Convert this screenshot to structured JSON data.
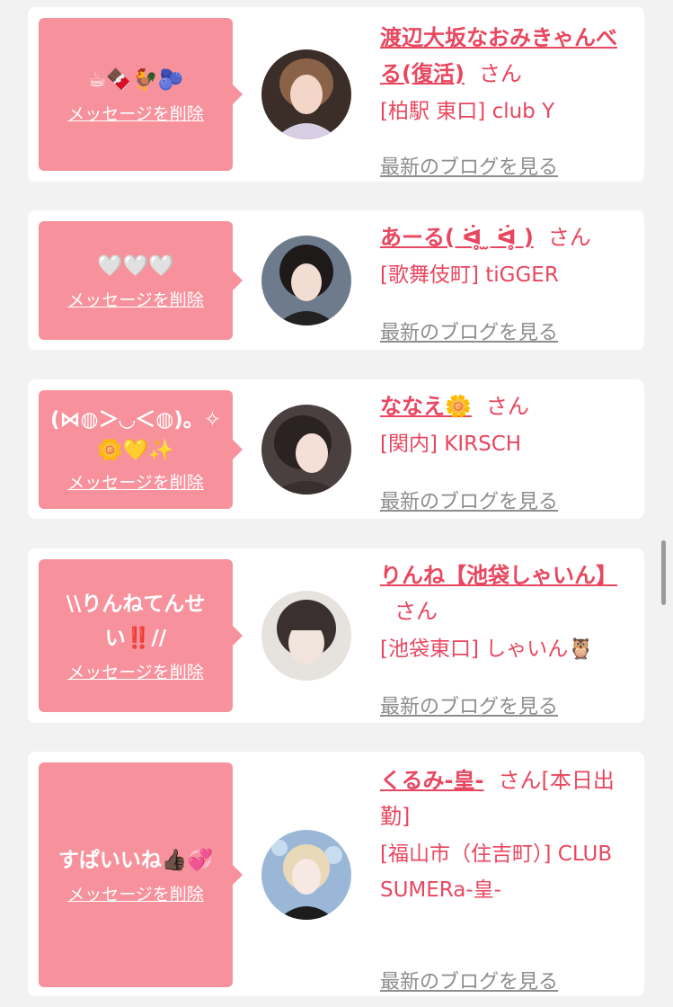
{
  "common": {
    "delete_label": "メッセージを削除",
    "blog_label": "最新のブログを見る",
    "san": "さん"
  },
  "cards": [
    {
      "message": "☕🍫🐓🫐",
      "name": "渡辺大坂なおみきゃんべる(復活)",
      "shop": "[柏駅 東口] club Y"
    },
    {
      "message": "🤍🤍🤍",
      "name": "あーる( ᐛ̥ ̫ ᐛ̥ )",
      "shop": "[歌舞伎町] tiGGER"
    },
    {
      "message": "(⋈◍＞◡＜◍)。✧\n🌼💛✨",
      "name": "ななえ🌼",
      "shop": "[関内] KIRSCH"
    },
    {
      "message": "\\\\りんねてんせい‼️//",
      "name": "りんね【池袋しゃいん】",
      "shop": "[池袋東口] しゃいん🦉"
    },
    {
      "message": "すぱいいね👍🏿💞",
      "name": "くるみ-皇-",
      "status": "[本日出勤]",
      "shop": "[福山市（住吉町）] CLUB SUMERa-皇-"
    }
  ]
}
